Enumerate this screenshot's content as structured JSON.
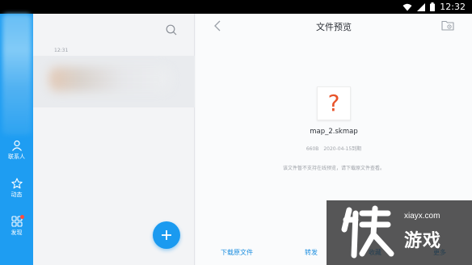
{
  "status_bar": {
    "time": "12:32",
    "icons": [
      "wifi-icon",
      "signal-icon",
      "battery-icon"
    ]
  },
  "rail": {
    "items": [
      {
        "name": "contacts",
        "label": "联系人",
        "icon": "person-icon"
      },
      {
        "name": "moments",
        "label": "动态",
        "icon": "star-icon"
      },
      {
        "name": "discover",
        "label": "发现",
        "icon": "apps-grid-icon",
        "badge": true
      }
    ]
  },
  "list": {
    "timestamp": "12:31",
    "search_icon": "search-icon"
  },
  "preview": {
    "title": "文件预览",
    "back_icon": "chevron-left-icon",
    "folder_icon": "folder-clock-icon",
    "file_icon_glyph": "?",
    "file_name": "map_2.skmap",
    "file_size": "660B",
    "file_expiry": "2020-04-15到期",
    "notice": "该文件暂不支持在线预览，请下载原文件查看。",
    "actions": {
      "download": "下载原文件",
      "forward": "转发",
      "favorite": "收藏",
      "more": "更多"
    }
  },
  "watermark": {
    "site": "xiayx.com",
    "name": "游戏"
  },
  "colors": {
    "accent": "#1e9df2",
    "warning_glyph": "#e8542b"
  }
}
